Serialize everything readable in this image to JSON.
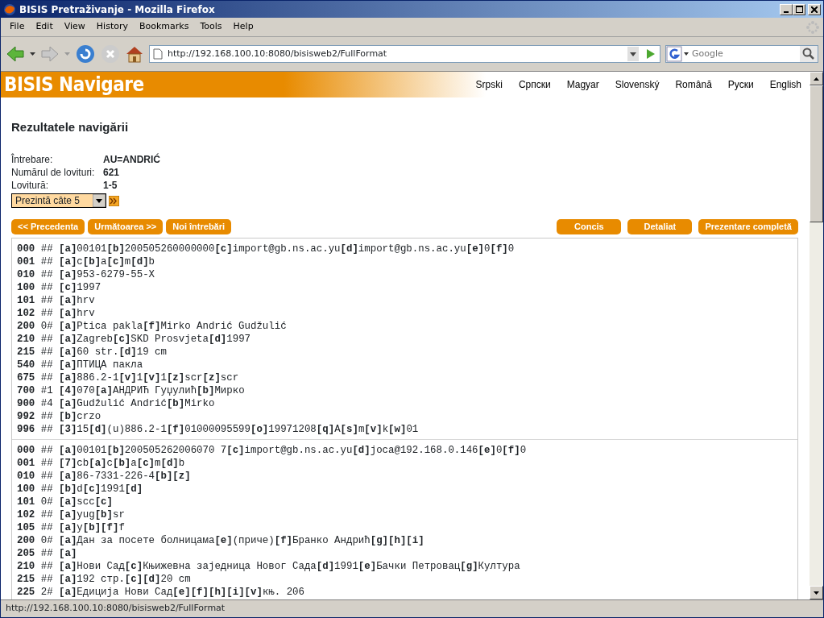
{
  "window": {
    "title": "BISIS Pretraživanje - Mozilla Firefox"
  },
  "menu": [
    "File",
    "Edit",
    "View",
    "History",
    "Bookmarks",
    "Tools",
    "Help"
  ],
  "toolbar": {
    "address": "http://192.168.100.10:8080/bisisweb2/FullFormat",
    "search_placeholder": "Google"
  },
  "header": {
    "logo": "BISIS Navigare",
    "languages": [
      "Srpski",
      "Српски",
      "Magyar",
      "Slovenský",
      "Română",
      "Руски",
      "English"
    ]
  },
  "heading": "Rezultatele navigării",
  "query": [
    {
      "label": "Întrebare:",
      "value": "AU=ANDRIĆ"
    },
    {
      "label": "Numărul de lovituri:",
      "value": "621"
    },
    {
      "label": "Lovitură:",
      "value": "1-5"
    }
  ],
  "page_size": "Prezintă câte 5",
  "nav_buttons": [
    "<< Precedenta",
    "Următoarea >>",
    "Noi întrebări"
  ],
  "format_buttons": [
    "Concis",
    "Detaliat",
    "Prezentare completă"
  ],
  "records": [
    {
      "fields": [
        {
          "tag": "000",
          "ind": "##",
          "content": "**[a]**00101**[b]**200505260000000**[c]**import@gb.ns.ac.yu**[d]**import@gb.ns.ac.yu**[e]**0**[f]**0"
        },
        {
          "tag": "001",
          "ind": "##",
          "content": "**[a]**c**[b]**a**[c]**m**[d]**b"
        },
        {
          "tag": "010",
          "ind": "##",
          "content": "**[a]**953-6279-55-X"
        },
        {
          "tag": "100",
          "ind": "##",
          "content": "**[c]**1997"
        },
        {
          "tag": "101",
          "ind": "##",
          "content": "**[a]**hrv"
        },
        {
          "tag": "102",
          "ind": "##",
          "content": "**[a]**hrv"
        },
        {
          "tag": "200",
          "ind": "0#",
          "content": "**[a]**Ptica pakla**[f]**Mirko Andrić Gudžulić"
        },
        {
          "tag": "210",
          "ind": "##",
          "content": "**[a]**Zagreb**[c]**SKD Prosvjeta**[d]**1997"
        },
        {
          "tag": "215",
          "ind": "##",
          "content": "**[a]**60 str.**[d]**19 cm"
        },
        {
          "tag": "540",
          "ind": "##",
          "content": "**[a]**ПТИЦА пакла"
        },
        {
          "tag": "675",
          "ind": "##",
          "content": "**[a]**886.2-1**[v]**1**[v]**1**[z]**scr**[z]**scr"
        },
        {
          "tag": "700",
          "ind": "#1",
          "content": "**[4]**070**[a]**АНДРИЋ Гуџулић**[b]**Мирко"
        },
        {
          "tag": "900",
          "ind": "#4",
          "content": "**[a]**Gudžulić Andrić**[b]**Mirko"
        },
        {
          "tag": "992",
          "ind": "##",
          "content": "**[b]**crzo"
        },
        {
          "tag": "996",
          "ind": "##",
          "content": "**[3]**15**[d]**(u)886.2-1**[f]**01000095599**[o]**19971208**[q]**A**[s]**m**[v]**k**[w]**01"
        }
      ]
    },
    {
      "fields": [
        {
          "tag": "000",
          "ind": "##",
          "content": "**[a]**00101**[b]**200505262006070 7**[c]**import@gb.ns.ac.yu**[d]**joca@192.168.0.146**[e]**0**[f]**0"
        },
        {
          "tag": "001",
          "ind": "##",
          "content": "**[7]**cb**[a]**c**[b]**a**[c]**m**[d]**b"
        },
        {
          "tag": "010",
          "ind": "##",
          "content": "**[a]**86-7331-226-4**[b]****[z]**"
        },
        {
          "tag": "100",
          "ind": "##",
          "content": "**[b]**d**[c]**1991**[d]**"
        },
        {
          "tag": "101",
          "ind": "0#",
          "content": "**[a]**scc**[c]**"
        },
        {
          "tag": "102",
          "ind": "##",
          "content": "**[a]**yug**[b]**sr"
        },
        {
          "tag": "105",
          "ind": "##",
          "content": "**[a]**y**[b]****[f]**f"
        },
        {
          "tag": "200",
          "ind": "0#",
          "content": "**[a]**Дан за посете болницама**[e]**(приче)**[f]**Бранко Андрић**[g]****[h]****[i]**"
        },
        {
          "tag": "205",
          "ind": "##",
          "content": "**[a]**"
        },
        {
          "tag": "210",
          "ind": "##",
          "content": "**[a]**Нови Сад**[c]**Књижевна заједница Новог Сада**[d]**1991**[e]**Бачки Петровац**[g]**Култура"
        },
        {
          "tag": "215",
          "ind": "##",
          "content": "**[a]**192 стр.**[c]****[d]**20 cm"
        },
        {
          "tag": "225",
          "ind": "2#",
          "content": "**[a]**Едиција Нови Сад**[e]****[f]****[h]****[i]****[v]**књ. 206"
        }
      ]
    }
  ],
  "status_bar": "http://192.168.100.10:8080/bisisweb2/FullFormat"
}
